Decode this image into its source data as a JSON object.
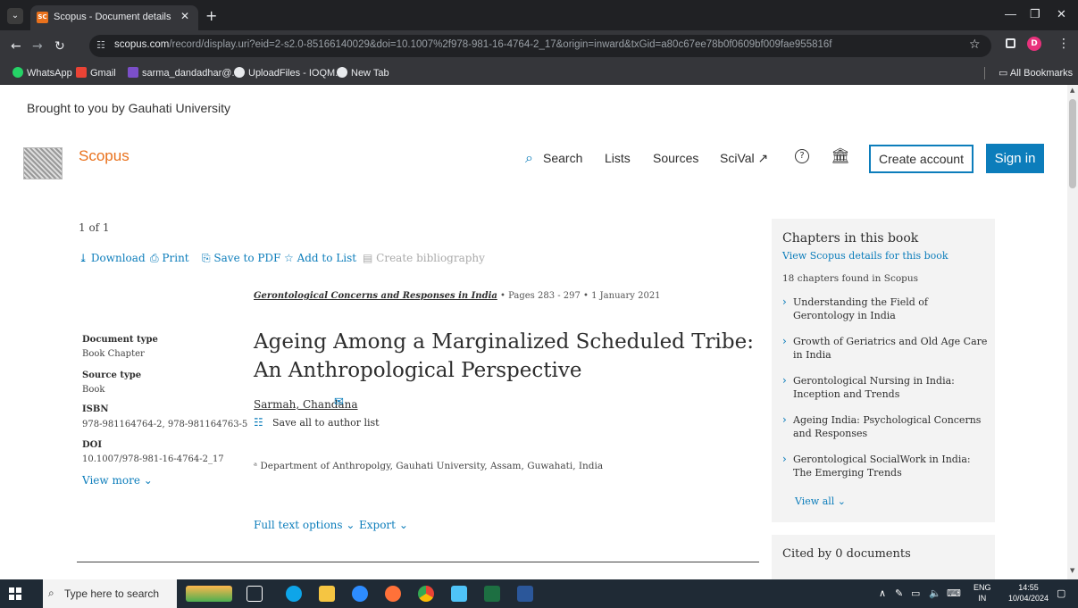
{
  "browser": {
    "tab_title": "Scopus - Document details - Ag",
    "tab_favicon": "SC",
    "url_host": "scopus.com",
    "url_path": "/record/display.uri?eid=2-s2.0-85166140029&doi=10.1007%2f978-981-16-4764-2_17&origin=inward&txGid=a80c67ee78b0f0609bf009fae955816f",
    "profile_initial": "D",
    "bookmarks": [
      "WhatsApp",
      "Gmail",
      "sarma_dandadhar@...",
      "UploadFiles - IOQM...",
      "New Tab"
    ],
    "all_bookmarks": "All Bookmarks"
  },
  "page": {
    "brought_by": "Brought to you by Gauhati University",
    "brand": "Scopus",
    "nav": {
      "search": "Search",
      "lists": "Lists",
      "sources": "Sources",
      "scival": "SciVal ↗",
      "create_account": "Create account",
      "sign_in": "Sign in"
    },
    "count": "1 of 1",
    "tools": {
      "download": "Download",
      "print": "Print",
      "save_pdf": "Save to PDF",
      "add_list": "Add to List",
      "create_bib": "Create bibliography"
    },
    "source": {
      "title": "Gerontological Concerns and Responses in India",
      "details": " • Pages 283 - 297 • 1 January 2021"
    },
    "meta": {
      "doc_type_label": "Document type",
      "doc_type": "Book Chapter",
      "source_type_label": "Source type",
      "source_type": "Book",
      "isbn_label": "ISBN",
      "isbn": "978-981164764-2, 978-981164763-5",
      "doi_label": "DOI",
      "doi": "10.1007/978-981-16-4764-2_17",
      "view_more": "View more"
    },
    "title_line1": "Ageing Among a Marginalized Scheduled Tribe:",
    "title_line2": "An Anthropological Perspective",
    "author": "Sarmah, Chandana",
    "save_author": "Save all to author list",
    "affiliation": "ᵃ Department of Anthropolgy, Gauhati University, Assam, Guwahati, India",
    "full_text": "Full text options",
    "export": "Export",
    "chapters": {
      "title": "Chapters in this book",
      "link": "View Scopus details for this book",
      "found": "18 chapters found in Scopus",
      "items": [
        "Understanding the Field of Gerontology in India",
        "Growth of Geriatrics and Old Age Care in India",
        "Gerontological Nursing in India: Inception and Trends",
        "Ageing India: Psychological Concerns and Responses",
        "Gerontological SocialWork in India: The Emerging Trends"
      ],
      "view_all": "View all"
    },
    "cited": "Cited by 0 documents"
  },
  "taskbar": {
    "search_placeholder": "Type here to search",
    "lang_top": "ENG",
    "lang_bottom": "IN",
    "time": "14:55",
    "date": "10/04/2024"
  }
}
